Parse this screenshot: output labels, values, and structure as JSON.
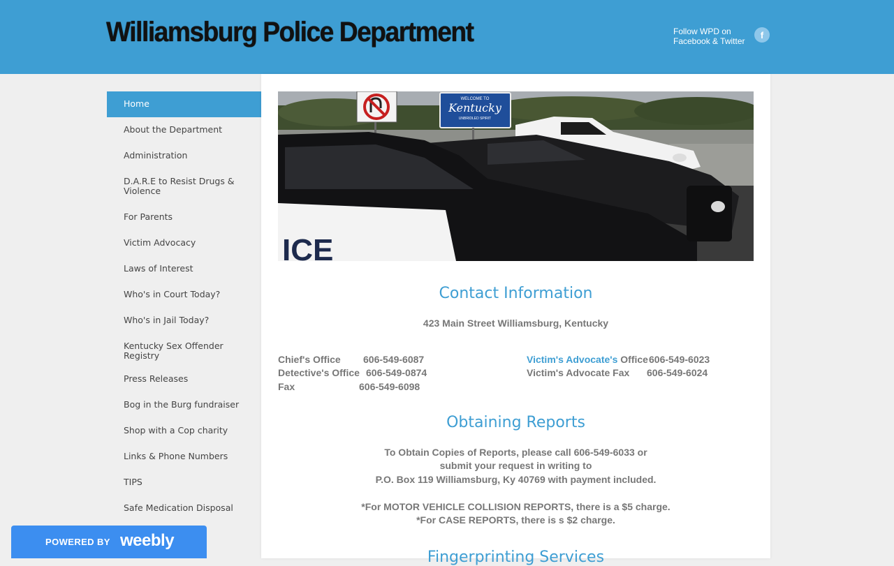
{
  "header": {
    "site_title": "Williamsburg Police Department",
    "follow_line1": "Follow WPD on",
    "follow_line2": "Facebook & Twitter",
    "facebook_icon": "f"
  },
  "colors": {
    "accent": "#3e9ed3",
    "sidebar_bg": "#efefef",
    "text": "#777777",
    "weebly": "#3c8ef0"
  },
  "sidebar": {
    "items": [
      {
        "label": "Home",
        "active": true
      },
      {
        "label": "About the Department"
      },
      {
        "label": "Administration"
      },
      {
        "label": "D.A.R.E to Resist Drugs & Violence"
      },
      {
        "label": "For Parents"
      },
      {
        "label": "Victim Advocacy"
      },
      {
        "label": "Laws of Interest"
      },
      {
        "label": "Who's in Court Today?"
      },
      {
        "label": "Who's in Jail Today?"
      },
      {
        "label": "Kentucky Sex Offender Registry"
      },
      {
        "label": "Press Releases"
      },
      {
        "label": "Bog in the Burg fundraiser"
      },
      {
        "label": "Shop with a Cop charity"
      },
      {
        "label": "Links & Phone Numbers"
      },
      {
        "label": "TIPS"
      },
      {
        "label": "Safe Medication Disposal"
      }
    ]
  },
  "hero": {
    "sign_title": "WELCOME TO",
    "sign_state": "Kentucky",
    "sign_sub": "UNBRIDLED SPIRIT",
    "car_text": "ICE"
  },
  "contact": {
    "title": "Contact Information",
    "address": "423 Main Street Williamsburg, Kentucky",
    "chief_label": "Chief's Office",
    "chief_phone": "606-549-6087",
    "detective_label": "Detective's Office",
    "detective_phone": "606-549-0874",
    "fax_label": "Fax",
    "fax_phone": "606-549-6098",
    "victim_link": "Victim's Advocate's",
    "victim_office": "Office",
    "victim_phone": "606-549-6023",
    "victim_fax_label": "Victim's Advocate Fax",
    "victim_fax_phone": "606-549-6024"
  },
  "reports": {
    "title": "Obtaining Reports",
    "line1": "To Obtain Copies of Reports, please call 606-549-6033 or",
    "line2": "submit your request in writing to",
    "line3": "P.O. Box 119 Williamsburg, Ky 40769 with payment included.",
    "line4": "*For MOTOR VEHICLE COLLISION REPORTS, there is a $5 charge.",
    "line5": "*For CASE REPORTS, there is s $2 charge."
  },
  "fingerprinting": {
    "title": "Fingerprinting Services"
  },
  "weebly": {
    "powered": "POWERED BY",
    "brand": "weebly"
  }
}
